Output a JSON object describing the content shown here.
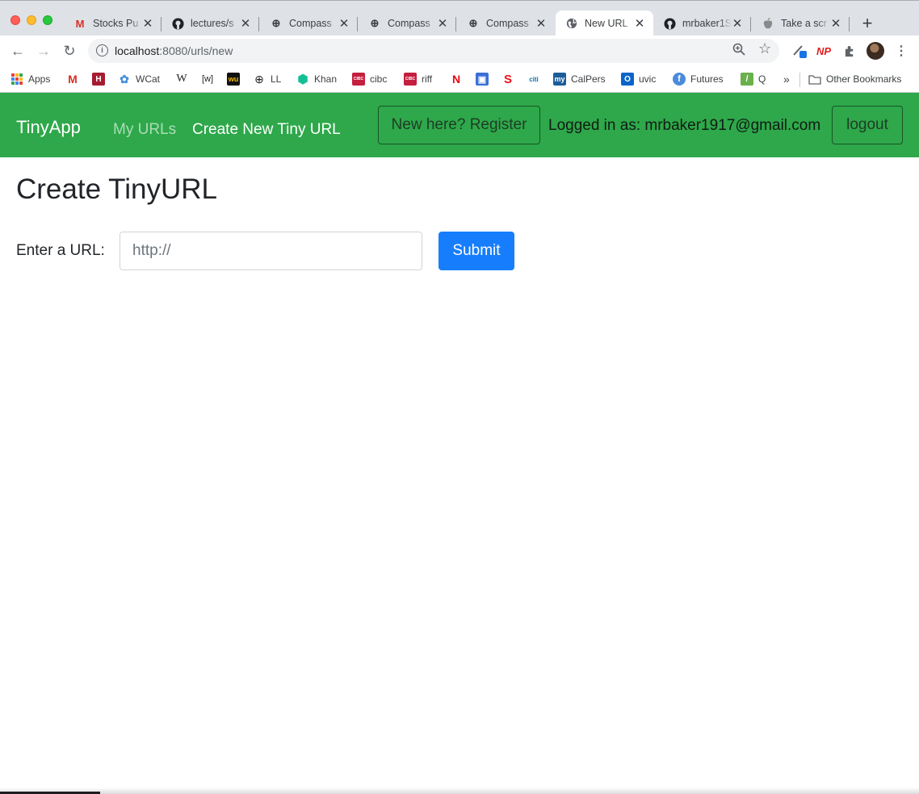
{
  "browser": {
    "tabs": [
      {
        "title": "Stocks Pu",
        "icon": "gmail-icon",
        "icon_glyph": "M",
        "icon_color": "#d93025"
      },
      {
        "title": "lectures/s",
        "icon": "github-icon",
        "icon_glyph": "●",
        "icon_color": "#202124"
      },
      {
        "title": "Compass",
        "icon": "compass-icon",
        "icon_glyph": "⊕",
        "icon_color": "#202124"
      },
      {
        "title": "Compass",
        "icon": "compass-icon",
        "icon_glyph": "⊕",
        "icon_color": "#202124"
      },
      {
        "title": "Compass",
        "icon": "compass-icon",
        "icon_glyph": "⊕",
        "icon_color": "#202124"
      },
      {
        "title": "New URL",
        "icon": "globe-icon",
        "icon_glyph": "◍",
        "icon_color": "#5f6368",
        "active": true
      },
      {
        "title": "mrbaker1S",
        "icon": "github-icon",
        "icon_glyph": "●",
        "icon_color": "#202124"
      },
      {
        "title": "Take a scr",
        "icon": "apple-icon",
        "icon_glyph": "",
        "icon_color": "#8a8a8a"
      }
    ],
    "address": {
      "host": "localhost",
      "path": ":8080/urls/new"
    },
    "bookmarks": [
      {
        "label": "Apps",
        "icon": "apps-grid-icon"
      },
      {
        "label": "",
        "icon": "gmail-icon",
        "glyph": "M",
        "color": "#d93025"
      },
      {
        "label": "",
        "icon": "harvard-icon",
        "glyph": "H",
        "color": "#a51c30"
      },
      {
        "label": "WCat",
        "icon": "worldcat-icon",
        "glyph": "✿",
        "color": "#4a90d9"
      },
      {
        "label": "",
        "icon": "wikipedia-icon",
        "glyph": "W",
        "color": "#202124"
      },
      {
        "label": "",
        "icon": "wiki-bracket-icon",
        "glyph": "[w]",
        "color": "#202124"
      },
      {
        "label": "",
        "icon": "wu-icon",
        "glyph": "wu",
        "color": "#f2b800"
      },
      {
        "label": "LL",
        "icon": "compass-icon",
        "glyph": "⊕",
        "color": "#202124"
      },
      {
        "label": "Khan",
        "icon": "khan-icon",
        "glyph": "⬢",
        "color": "#14bf96"
      },
      {
        "label": "cibc",
        "icon": "cibc-icon",
        "glyph": "CIBC",
        "color": "#c41f3e"
      },
      {
        "label": "riff",
        "icon": "cibc-icon",
        "glyph": "CIBC",
        "color": "#c41f3e"
      },
      {
        "label": "",
        "icon": "netflix-icon",
        "glyph": "N",
        "color": "#e50914"
      },
      {
        "label": "",
        "icon": "calendar-icon",
        "glyph": "▣",
        "color": "#3a6fd8"
      },
      {
        "label": "",
        "icon": "scotiabank-icon",
        "glyph": "S",
        "color": "#ec111a"
      },
      {
        "label": "",
        "icon": "citi-icon",
        "glyph": "citi",
        "color": "#056dae"
      },
      {
        "label": "CalPers",
        "icon": "my-icon",
        "glyph": "my",
        "color": "#1c5d99"
      },
      {
        "label": "uvic",
        "icon": "outlook-icon",
        "glyph": "O",
        "color": "#0a64c8"
      },
      {
        "label": "Futures",
        "icon": "futures-icon",
        "glyph": "f",
        "color": "#4a8bdc"
      },
      {
        "label": "Q",
        "icon": "q-icon",
        "glyph": "/",
        "color": "#6ab04c"
      }
    ],
    "bookmarks_overflow": "»",
    "other_bookmarks": "Other Bookmarks"
  },
  "app": {
    "brand": "TinyApp",
    "nav": {
      "my_urls": "My URLs",
      "create_new": "Create New Tiny URL",
      "register": "New here? Register",
      "logged_in": "Logged in as: mrbaker1917@gmail.com",
      "logout": "logout"
    },
    "heading": "Create TinyURL",
    "form": {
      "label": "Enter a URL:",
      "placeholder": "http://",
      "value": "",
      "submit": "Submit"
    },
    "colors": {
      "navbar": "#2ea84a",
      "primary": "#167efc"
    }
  }
}
